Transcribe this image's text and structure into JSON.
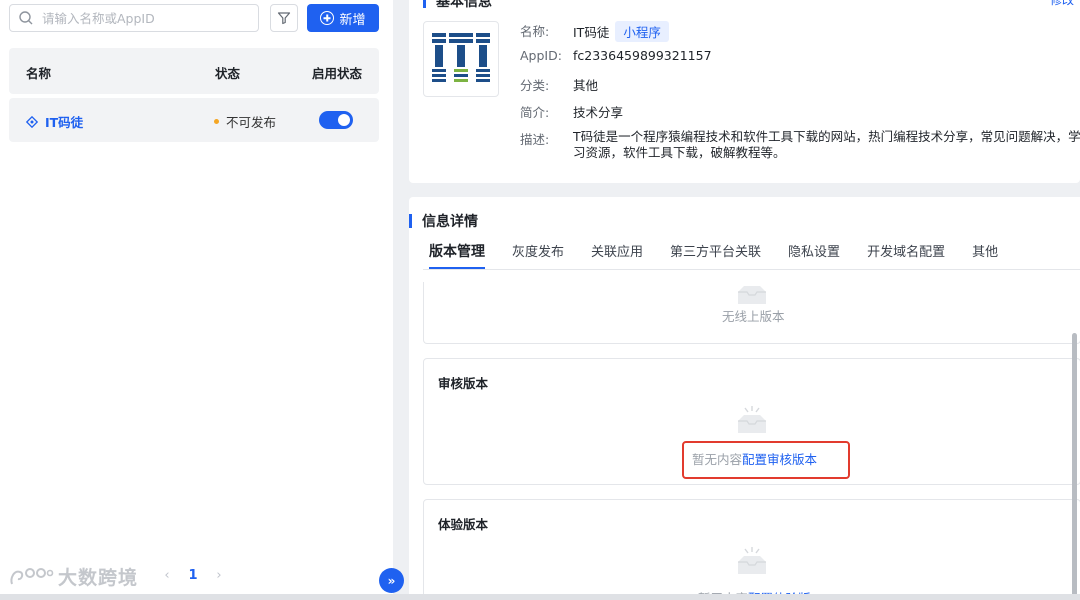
{
  "sidebar": {
    "search_placeholder": "请输入名称或AppID",
    "add_label": "新增",
    "columns": [
      "名称",
      "状态",
      "启用状态"
    ],
    "rows": [
      {
        "name": "IT码徒",
        "status": "不可发布",
        "enabled": true
      }
    ],
    "pager": {
      "prev": "‹",
      "current": "1",
      "next": "›"
    },
    "watermark": "大数跨境",
    "collapse_icon": "»"
  },
  "basic_info": {
    "title": "基本信息",
    "edit_label": "修改",
    "fields": {
      "name_label": "名称:",
      "name_value": "IT码徒",
      "name_tag": "小程序",
      "appid_label": "AppID:",
      "appid_value": "fc2336459899321157",
      "category_label": "分类:",
      "category_value": "其他",
      "intro_label": "简介:",
      "intro_value": "技术分享",
      "desc_label": "描述:",
      "desc_value": "T码徒是一个程序猿编程技术和软件工具下载的网站，热门编程技术分享，常见问题解决，学习资源，软件工具下载，破解教程等。"
    }
  },
  "details": {
    "title": "信息详情",
    "tabs": [
      "版本管理",
      "灰度发布",
      "关联应用",
      "第三方平台关联",
      "隐私设置",
      "开发域名配置",
      "其他"
    ],
    "active_tab": 0,
    "online": {
      "empty_text": "无线上版本"
    },
    "review": {
      "title": "审核版本",
      "empty_text": "暂无内容",
      "link": "配置审核版本"
    },
    "trial": {
      "title": "体验版本",
      "empty_text": "暂无内容",
      "link": "配置体验版"
    }
  },
  "colors": {
    "accent": "#1f61f0",
    "highlight": "#e23b2e",
    "warning": "#f5a623"
  }
}
